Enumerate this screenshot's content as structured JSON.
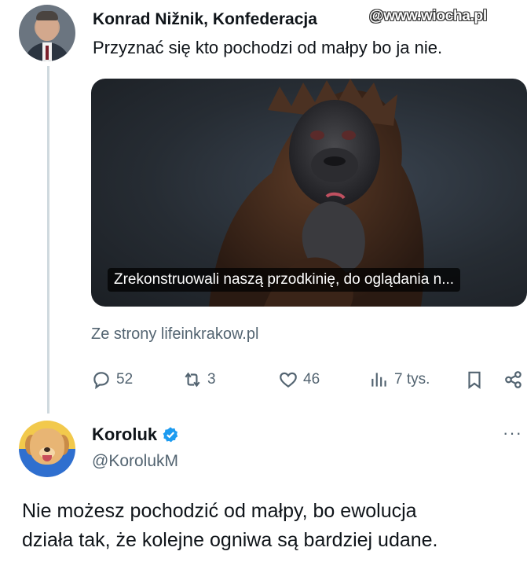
{
  "tweet1": {
    "author_name": "Konrad Nižnik, Konfederacja",
    "watermark": "@www.wiocha.pl",
    "text": "Przyznać się kto pochodzi od małpy bo ja nie.",
    "card": {
      "caption": "Zrekonstruowali naszą przodkinię, do oglądania n...",
      "source": "Ze strony lifeinkrakow.pl"
    },
    "actions": {
      "replies": "52",
      "reposts": "3",
      "likes": "46",
      "views": "7 tys."
    },
    "icons": [
      "reply-icon",
      "repost-icon",
      "like-icon",
      "views-icon",
      "bookmark-icon",
      "share-icon"
    ]
  },
  "tweet2": {
    "author_name": "Koroluk",
    "handle": "@KorolukM",
    "more": "···",
    "text_line1": "Nie możesz pochodzić od małpy, bo ewolucja",
    "text_line2": "działa tak, że kolejne ogniwa są bardziej udane."
  },
  "colors": {
    "text": "#0f1419",
    "secondary": "#536471",
    "verified": "#1d9bf0",
    "thread_line": "#cfd9de"
  }
}
